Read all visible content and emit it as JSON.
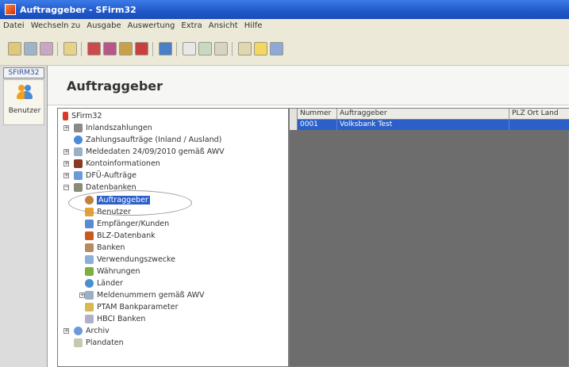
{
  "window": {
    "title": "Auftraggeber - SFirm32"
  },
  "menu": [
    "Datei",
    "Wechseln zu",
    "Ausgabe",
    "Auswertung",
    "Extra",
    "Ansicht",
    "Hilfe"
  ],
  "left_panel": {
    "tab_label": "SFIRM32",
    "button_label": "Benutzer"
  },
  "header": {
    "title": "Auftraggeber"
  },
  "tree": [
    {
      "label": "SFirm32"
    },
    {
      "label": "Inlandszahlungen"
    },
    {
      "label": "Zahlungsaufträge (Inland / Ausland)"
    },
    {
      "label": "Meldedaten 24/09/2010 gemäß AWV"
    },
    {
      "label": "Kontoinformationen"
    },
    {
      "label": "DFÜ-Aufträge"
    },
    {
      "label": "Datenbanken"
    },
    {
      "label": "Auftraggeber"
    },
    {
      "label": "Benutzer"
    },
    {
      "label": "Empfänger/Kunden"
    },
    {
      "label": "BLZ-Datenbank"
    },
    {
      "label": "Banken"
    },
    {
      "label": "Verwendungszwecke"
    },
    {
      "label": "Währungen"
    },
    {
      "label": "Länder"
    },
    {
      "label": "Meldenummern gemäß AWV"
    },
    {
      "label": "PTAM Bankparameter"
    },
    {
      "label": "HBCI Banken"
    },
    {
      "label": "Archiv"
    },
    {
      "label": "Plandaten"
    }
  ],
  "grid": {
    "columns": [
      "Nummer",
      "Auftraggeber",
      "PLZ Ort Land"
    ],
    "rows": [
      [
        "0001",
        "Volksbank Test",
        ""
      ]
    ]
  }
}
